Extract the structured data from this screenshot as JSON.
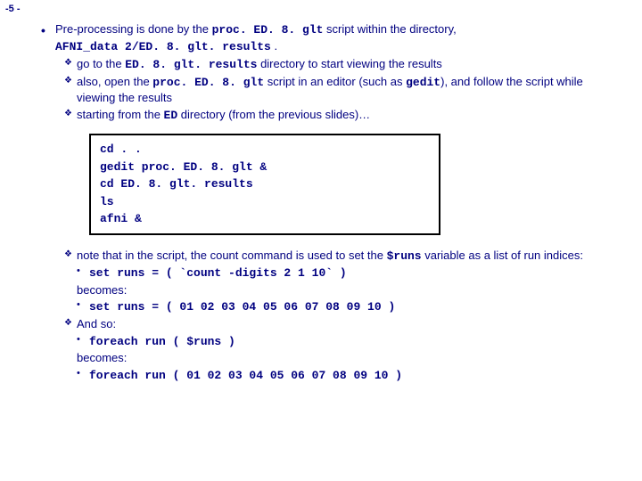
{
  "page_number": "-5 -",
  "main": {
    "line1_a": "Pre-processing is done by the ",
    "line1_code": "proc. ED. 8. glt",
    "line1_b": " script within the directory,",
    "line2_code": "AFNI_data 2/ED. 8. glt. results",
    "line2_b": " ."
  },
  "subs": {
    "s1_a": "go to the ",
    "s1_code": "ED. 8. glt. results",
    "s1_b": " directory to start viewing the results",
    "s2_a": "also, open the ",
    "s2_code1": "proc. ED. 8. glt",
    "s2_b": " script in an editor (such as ",
    "s2_code2": "gedit",
    "s2_c": "), and follow the script while viewing the results",
    "s3_a": "starting from the ",
    "s3_code": "ED",
    "s3_b": " directory (from the previous slides)…"
  },
  "code": {
    "l1": "cd . .",
    "l2": "gedit proc. ED. 8. glt &",
    "l3": "cd ED. 8. glt. results",
    "l4": "ls",
    "l5": "afni &"
  },
  "notes": {
    "n1_a": "note that in the script, the count command is used to set the ",
    "n1_code": "$runs",
    "n1_b": " variable as a list of run indices:",
    "n1_set1": "set runs = ( `count -digits 2 1 10` )",
    "becomes": "becomes:",
    "n1_set2": "set runs = ( 01 02 03 04 05 06 07 08 09 10 )",
    "n2": "And so:",
    "n2_fe1": "foreach run ( $runs )",
    "n2_fe2": "foreach run ( 01 02 03 04 05 06 07 08 09 10 )"
  }
}
